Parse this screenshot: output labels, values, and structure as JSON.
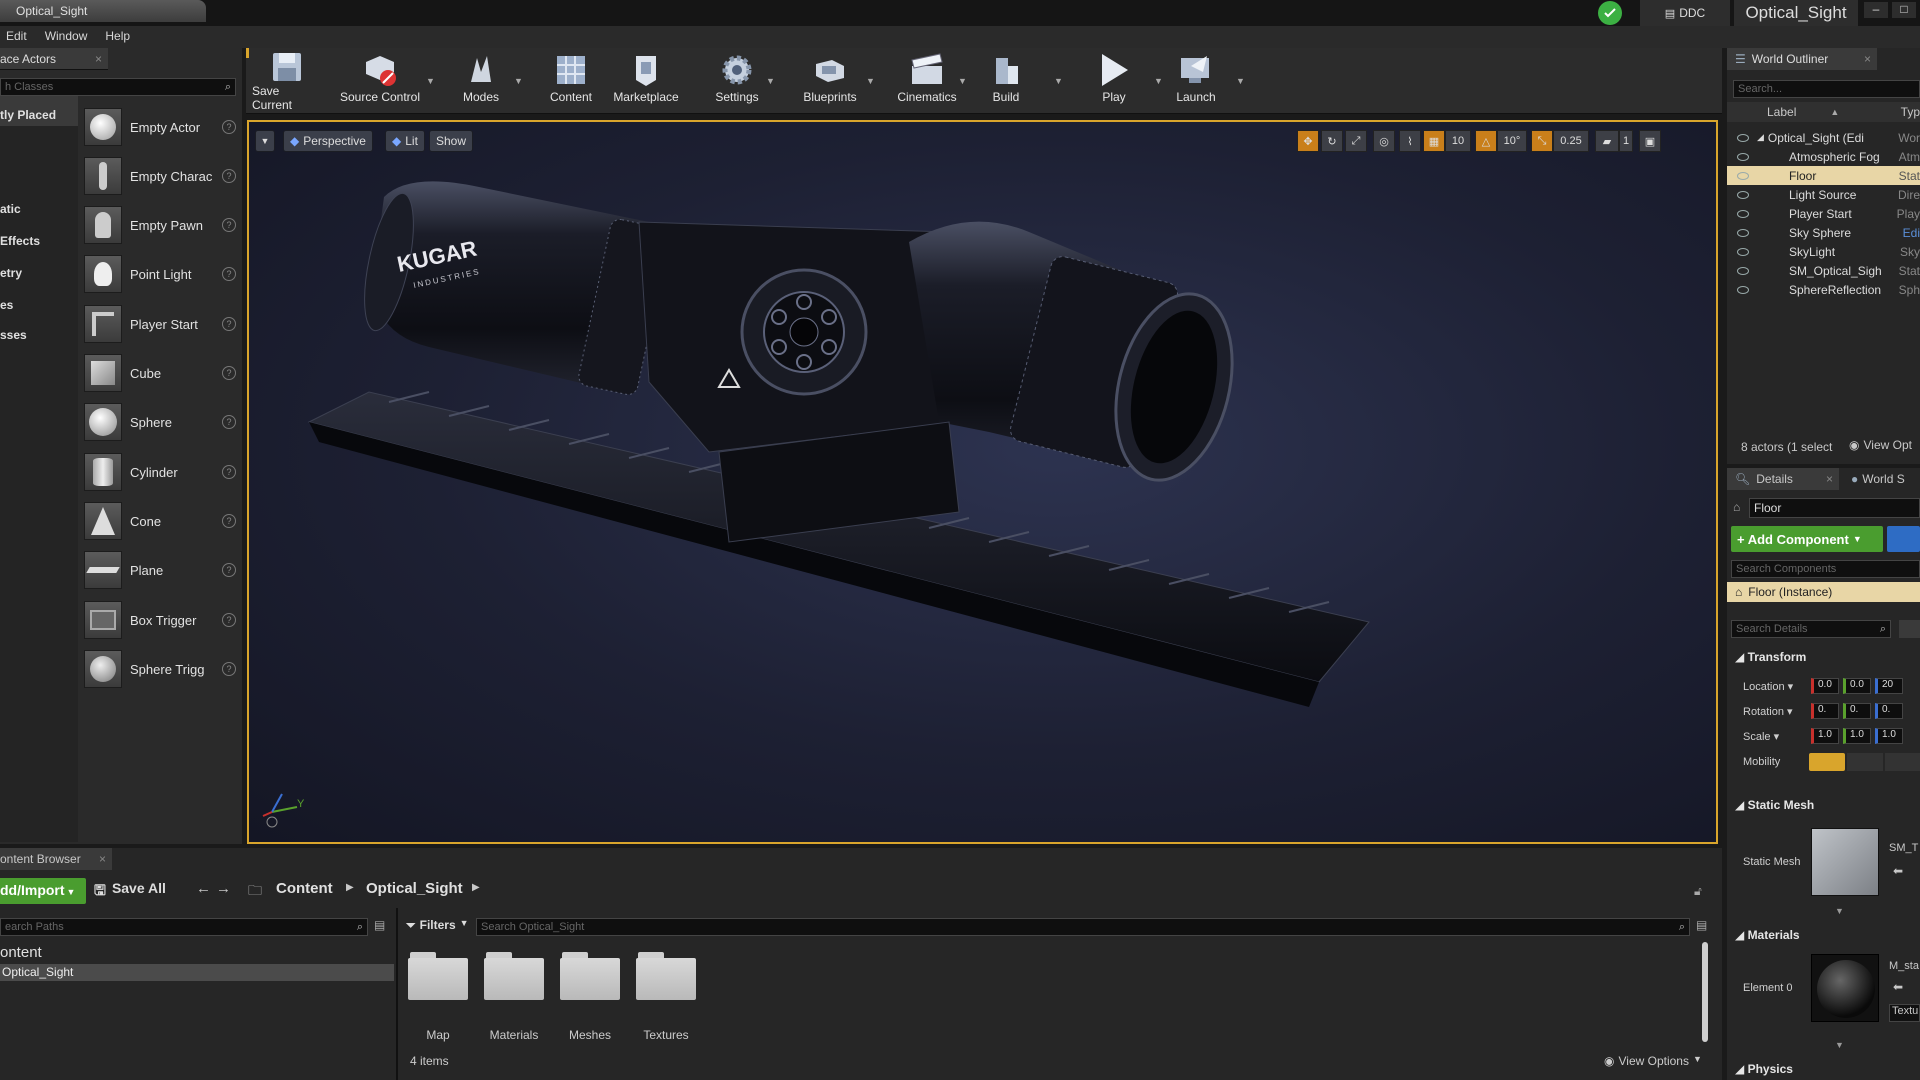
{
  "window": {
    "tab_title": "Optical_Sight",
    "ddc_label": "DDC",
    "project_name": "Optical_Sight"
  },
  "menu": [
    "Edit",
    "Window",
    "Help"
  ],
  "place_panel": {
    "tab_label": "ace Actors",
    "search_placeholder": "h Classes",
    "categories": [
      "tly Placed",
      "atic",
      "Effects",
      "etry",
      "es",
      "sses"
    ],
    "actors": [
      "Empty Actor",
      "Empty Charac",
      "Empty Pawn",
      "Point Light",
      "Player Start",
      "Cube",
      "Sphere",
      "Cylinder",
      "Cone",
      "Plane",
      "Box Trigger",
      "Sphere Trigg"
    ]
  },
  "toolbar": {
    "buttons": [
      "Save Current",
      "Source Control",
      "Modes",
      "Content",
      "Marketplace",
      "Settings",
      "Blueprints",
      "Cinematics",
      "Build",
      "Play",
      "Launch"
    ]
  },
  "viewport": {
    "perspective": "Perspective",
    "lit": "Lit",
    "show": "Show",
    "grid_snap": "10",
    "rot_snap": "10°",
    "scale_snap": "0.25",
    "cam_speed": "1",
    "axis_y": "Y",
    "model_brand": "KUGAR",
    "model_sub": "INDUSTRIES"
  },
  "outliner": {
    "tab_label": "World Outliner",
    "search_placeholder": "Search...",
    "col_label": "Label",
    "col_type": "Typ",
    "rows": [
      {
        "label": "Optical_Sight (Edito",
        "type": "Wor"
      },
      {
        "label": "Atmospheric Fog",
        "type": "Atm"
      },
      {
        "label": "Floor",
        "type": "Stat"
      },
      {
        "label": "Light Source",
        "type": "Dire"
      },
      {
        "label": "Player Start",
        "type": "Play"
      },
      {
        "label": "Sky Sphere",
        "type": "Edi"
      },
      {
        "label": "SkyLight",
        "type": "Sky"
      },
      {
        "label": "SM_Optical_Sigh",
        "type": "Stat"
      },
      {
        "label": "SphereReflection",
        "type": "Sph"
      }
    ],
    "footer_count": "8 actors (1 select",
    "footer_view": "View Opt"
  },
  "details": {
    "tab_details": "Details",
    "tab_world": "World S",
    "object_name": "Floor",
    "add_component": "+ Add Component",
    "search_components": "Search Components",
    "instance": "Floor (Instance)",
    "search_details": "Search Details",
    "transform": "Transform",
    "location": "Location",
    "rotation": "Rotation",
    "scale": "Scale",
    "mobility": "Mobility",
    "loc_vals": [
      "0.0",
      "0.0",
      "20"
    ],
    "rot_vals": [
      "0.",
      "0.",
      "0."
    ],
    "scale_vals": [
      "1.0",
      "1.0",
      "1.0"
    ],
    "static_mesh_section": "Static Mesh",
    "static_mesh_label": "Static Mesh",
    "mesh_name": "SM_T",
    "materials_section": "Materials",
    "element0": "Element 0",
    "material_name": "M_sta",
    "material_sub": "Textu",
    "physics_section": "Physics"
  },
  "content_browser": {
    "tab_label": "ontent Browser",
    "add_import": "dd/Import",
    "save_all": "Save All",
    "crumb_root": "Content",
    "crumb_child": "Optical_Sight",
    "search_paths": "earch Paths",
    "tree_root": "ontent",
    "tree_child": "Optical_Sight",
    "filters": "Filters",
    "search_assets": "Search Optical_Sight",
    "folders": [
      "Map",
      "Materials",
      "Meshes",
      "Textures"
    ],
    "item_count": "4 items",
    "view_options": "View Options"
  },
  "colors": {
    "accent_orange": "#d9a52c",
    "add_green": "#4a9d2f",
    "selected_row": "#e8d6a6"
  }
}
